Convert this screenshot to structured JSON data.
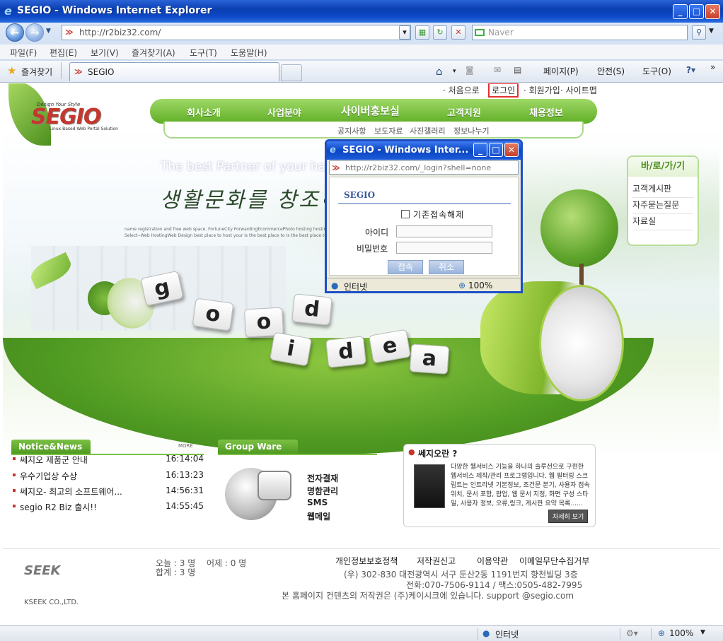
{
  "window": {
    "title": "SEGIO - Windows Internet Explorer"
  },
  "address": {
    "url": "http://r2biz32.com/",
    "search_placeholder": "Naver"
  },
  "menu": [
    "파일(F)",
    "편집(E)",
    "보기(V)",
    "즐겨찾기(A)",
    "도구(T)",
    "도움말(H)"
  ],
  "favorites": {
    "label": "즐겨찾기",
    "tab": "SEGIO"
  },
  "commandbar": {
    "page": "페이지(P)",
    "safety": "안전(S)",
    "tools": "도구(O)"
  },
  "site": {
    "logo_tag": "Design Your Style",
    "logo": "SEGIO",
    "logo_sub": "Linux Based Web Portal Solution",
    "util": [
      "· 처음으로",
      "로그인",
      "· 회원가입",
      "· 사이트맵"
    ],
    "gnb": [
      "회사소개",
      "사업분야",
      "사이버홍보실",
      "고객지원",
      "채용정보"
    ],
    "snb": [
      "공지사항",
      "보도자료",
      "사진갤러리",
      "정보나누기"
    ],
    "hero_tagline": "The best Partner of your happ",
    "hero_korean": "생활문화를 창조하는",
    "hero_small": "name registration and free web space. FortuneCity ForwardingEcommercePhoto hosting hosting, desig",
    "hero_small2": "Select--Web HostingWeb Design best place to host your is the best place to is the best place to host",
    "tiles_good": [
      "g",
      "o",
      "o",
      "d"
    ],
    "tiles_idea": [
      "i",
      "d",
      "e",
      "a"
    ],
    "quick": {
      "title": "바/로/가/기",
      "items": [
        "고객게시판",
        "자주묻는질문",
        "자료실"
      ]
    },
    "news": {
      "title": "Notice&News",
      "more": "MORE",
      "items": [
        {
          "title": "쎄지오 제품군 안내",
          "time": "16:14:04"
        },
        {
          "title": "우수기업상 수상",
          "time": "16:13:23"
        },
        {
          "title": "쎄지오- 최고의 소프트웨어...",
          "time": "14:56:31"
        },
        {
          "title": "segio R2 Biz 출시!!",
          "time": "14:55:45"
        }
      ]
    },
    "groupware": {
      "title": "Group Ware",
      "items": [
        "전자결재",
        "명함관리",
        "SMS",
        "웹메일"
      ]
    },
    "segio_box": {
      "title": "쎄지오란 ?",
      "desc": "다양한 웹서비스 기능을 하나의 솔루션으로 구현한 웹서비스 제작/관리 프로그램입니다. 웹 필터링 스크립트는 인트라넷 기본정보, 조건문 분기, 사용자 접속위치, 문서 포함, 팝업, 웹 문서 지정, 화면 구성 스타일, 사용자 정보, 오류,링크, 게시판 요약 목록......",
      "button": "자세히 보기"
    },
    "footer": {
      "today": "오늘 : 3 명",
      "yesterday": "어제 : 0 명",
      "total": "합계 : 3 명",
      "links": [
        "개인정보보호정책",
        "저작권신고",
        "이용약관",
        "이메일무단수집거부"
      ],
      "address": "(우) 302-830 대전광역시 서구 둔산2동 1191번지 향천빌딩 3층",
      "phone": "전화:070-7506-9114 / 팩스:0505-482-7995",
      "copyright": "본 홈페이지 컨텐츠의 저작권은 (주)케이시크에 있습니다. support @segio.com",
      "logo": "SEEK",
      "logo_sub": "KSEEK CO.,LTD."
    }
  },
  "popup": {
    "title": "SEGIO - Windows Inter...",
    "url": "http://r2biz32.com/_login?shell=none",
    "heading": "SEGIO",
    "checkbox": "기존접속해제",
    "id_label": "아이디",
    "pw_label": "비밀번호",
    "ok": "접속",
    "cancel": "취소",
    "status": "인터넷",
    "zoom": "100%"
  },
  "status": {
    "zone": "인터넷",
    "zoom": "100%"
  }
}
